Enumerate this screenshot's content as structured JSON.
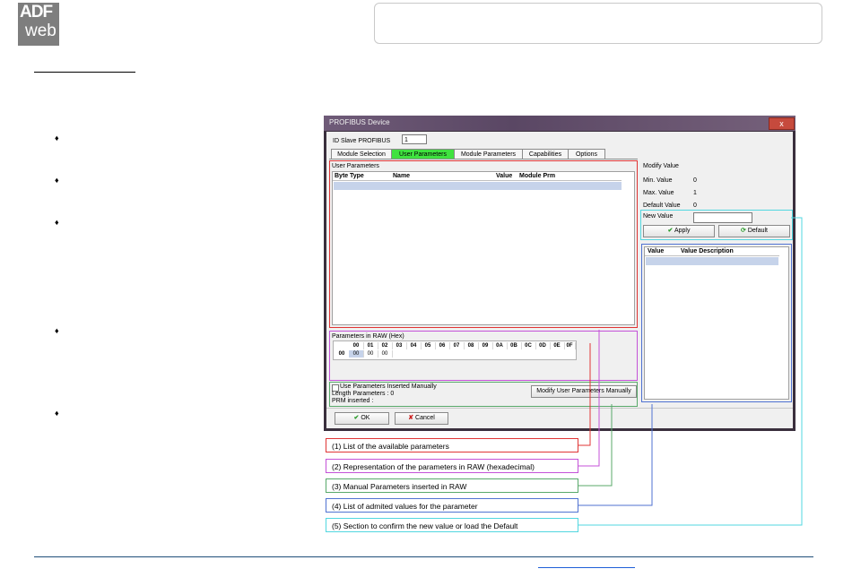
{
  "logo": {
    "line1": "ADF",
    "line2": "web"
  },
  "dialog": {
    "title": "PROFIBUS Device",
    "close_label": "x",
    "id_slave_label": "ID Slave PROFIBUS",
    "id_slave_value": "1",
    "tabs": [
      "Module Selection",
      "User Parameters",
      "Module Parameters",
      "Capabilities",
      "Options"
    ],
    "active_tab": "User Parameters",
    "user_params": {
      "title": "User Parameters",
      "columns": [
        "Byte",
        "Type",
        "Name",
        "Value",
        "Module Prm"
      ]
    },
    "raw": {
      "title": "Parameters in RAW (Hex)",
      "col_headers": [
        "00",
        "01",
        "02",
        "03",
        "04",
        "05",
        "06",
        "07",
        "08",
        "09",
        "0A",
        "0B",
        "0C",
        "0D",
        "0E",
        "0F"
      ],
      "row_header": "00",
      "values": [
        "00",
        "00",
        "00"
      ]
    },
    "manual": {
      "checkbox_label": "Use Parameters Inserted Manually",
      "length_label": "Length Parameters : 0",
      "prm_label": "PRM inserted :",
      "button": "Modify User Parameters Manually"
    },
    "modify": {
      "title": "Modify Value",
      "min_label": "Min. Value",
      "min_value": "0",
      "max_label": "Max. Value",
      "max_value": "1",
      "default_label": "Default Value",
      "default_value": "0",
      "new_value_label": "New Value",
      "apply": "Apply",
      "default_btn": "Default",
      "columns": [
        "Value",
        "Value Description"
      ]
    },
    "ok": "OK",
    "cancel": "Cancel"
  },
  "callouts": [
    "(1) List of the available parameters",
    "(2) Representation of the parameters in RAW (hexadecimal)",
    "(3) Manual Parameters inserted in RAW",
    "(4) List of admited values for the parameter",
    "(5) Section to confirm the new value or load the Default"
  ],
  "colors": {
    "c1": "#e03535",
    "c2": "#c452d8",
    "c3": "#58a96a",
    "c4": "#4f72d2",
    "c5": "#52d7e0",
    "active_tab": "#3fe23f"
  },
  "bullets": [
    "•",
    "•",
    "•",
    "•",
    "•"
  ]
}
